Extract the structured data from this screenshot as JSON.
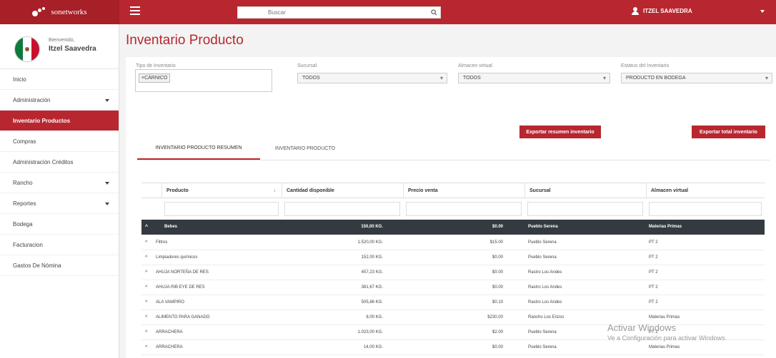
{
  "brand": {
    "name": "sonetworks"
  },
  "header": {
    "search_placeholder": "Buscar",
    "user_name": "ITZEL SAAVEDRA"
  },
  "profile": {
    "welcome": "Bienvenido,",
    "name": "Itzel Saavedra"
  },
  "sidebar": {
    "items": [
      {
        "label": "Inicio"
      },
      {
        "label": "Administración"
      },
      {
        "label": "Inventario Productos"
      },
      {
        "label": "Compras"
      },
      {
        "label": "Administración Créditos"
      },
      {
        "label": "Rancho"
      },
      {
        "label": "Reportes"
      },
      {
        "label": "Bodega"
      },
      {
        "label": "Facturacion"
      },
      {
        "label": "Gastos De Nómina"
      }
    ]
  },
  "page": {
    "title": "Inventario Producto"
  },
  "filters": {
    "tipo_label": "Tipo de Inventario",
    "tipo_chip": "×CÁRNICO",
    "sucursal_label": "Sucursal",
    "sucursal_value": "TODOS",
    "almacen_label": "Almacen virtual",
    "almacen_value": "TODOS",
    "estatus_label": "Estatus del Inventario",
    "estatus_value": "PRODUCTO EN BODEGA"
  },
  "buttons": {
    "export_summary": "Exportar resumen inventario",
    "export_total": "Exportar total inventario"
  },
  "tabs": [
    {
      "label": "INVENTARIO PRODUCTO RESUMEN"
    },
    {
      "label": "INVENTARIO PRODUCTO"
    }
  ],
  "table": {
    "columns": [
      "Producto",
      "Cantidad disponible",
      "Precio venta",
      "Sucursal",
      "Almacen virtual"
    ],
    "group": {
      "producto": "Bebes",
      "cantidad": "150,00 KG.",
      "precio": "$0.00",
      "sucursal": "Pueblo Serena",
      "almacen": "Materias Primas"
    },
    "rows": [
      {
        "producto": "Filtros",
        "cantidad": "1.520,00 KG.",
        "precio": "$15.00",
        "sucursal": "Pueblo Serena",
        "almacen": "PT 2"
      },
      {
        "producto": "Limpiadores químicos",
        "cantidad": "152,00 KG.",
        "precio": "$0.00",
        "sucursal": "Pueblo Serena",
        "almacen": "PT 2"
      },
      {
        "producto": "AHUJA NORTEÑA DE RES",
        "cantidad": "457,23 KG.",
        "precio": "$0.00",
        "sucursal": "Rastro Los Andes",
        "almacen": "PT 2"
      },
      {
        "producto": "AHUJA RIB EYE DE RES",
        "cantidad": "381,67 KG.",
        "precio": "$0.00",
        "sucursal": "Rastro Los Andes",
        "almacen": "PT 2"
      },
      {
        "producto": "ALA VAMPIRO",
        "cantidad": "505,86 KG.",
        "precio": "$0.10",
        "sucursal": "Rastro Los Andes",
        "almacen": "PT 2"
      },
      {
        "producto": "ALIMENTO PARA GANADO",
        "cantidad": "8,00 KG.",
        "precio": "$230.00",
        "sucursal": "Rancho Los Erizos",
        "almacen": "Materias Primas"
      },
      {
        "producto": "ARRACHERA",
        "cantidad": "1.023,00 KG.",
        "precio": "$2.00",
        "sucursal": "Pueblo Serena",
        "almacen": "PT 2"
      },
      {
        "producto": "ARRACHERA",
        "cantidad": "14,00 KG.",
        "precio": "$0.00",
        "sucursal": "Pueblo Serena",
        "almacen": "Materias Primas"
      }
    ]
  },
  "watermark": {
    "line1": "Activar Windows",
    "line2": "Ve a Configuración para activar Windows."
  },
  "colors": {
    "accent": "#b8272f",
    "dark_row": "#343a40"
  }
}
